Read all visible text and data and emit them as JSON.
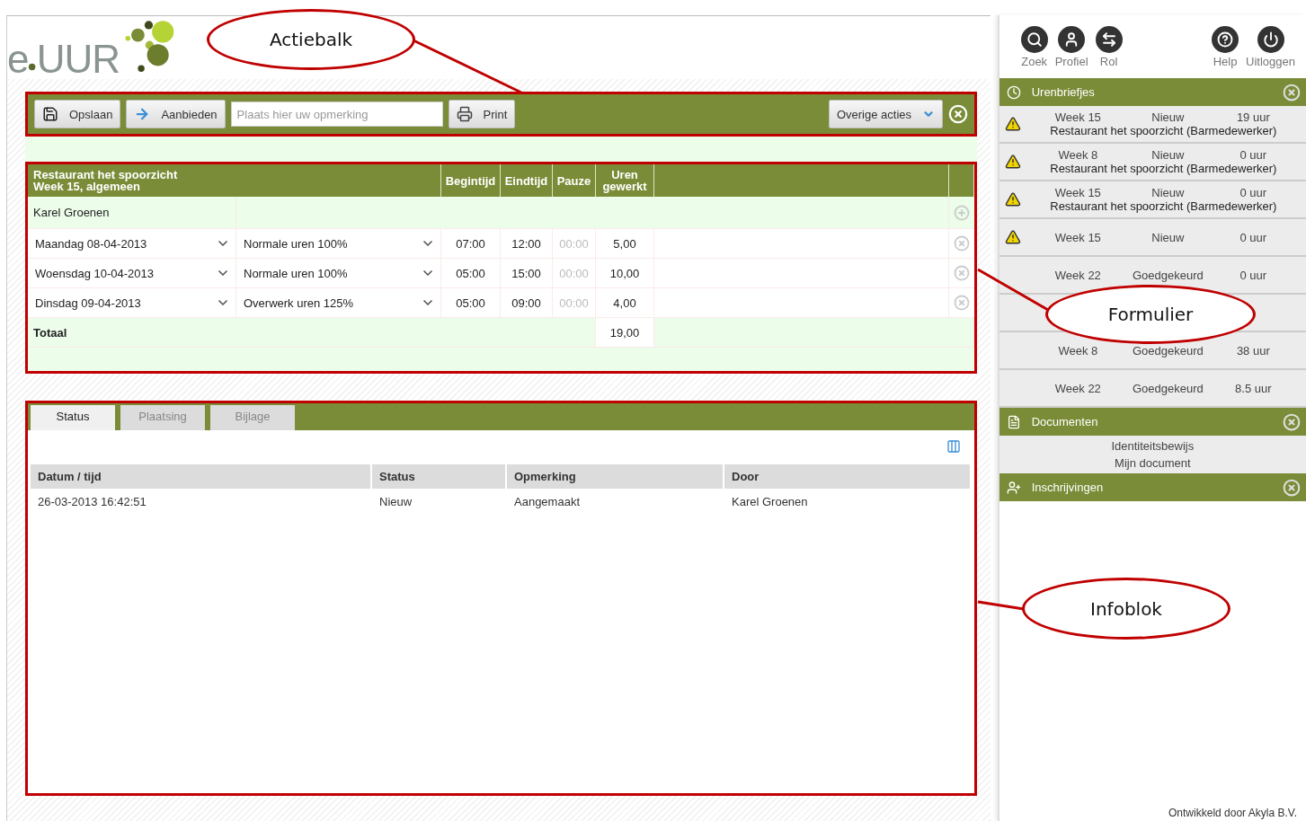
{
  "logo": {
    "left": "e",
    "right": "UUR"
  },
  "toolbar": {
    "items": [
      {
        "kind": "button",
        "label": "Opslaan"
      },
      {
        "kind": "button",
        "label": "Aanbieden"
      },
      {
        "kind": "field",
        "placeholder": "Plaats hier uw opmerking"
      },
      {
        "kind": "button",
        "label": "Print"
      }
    ],
    "menu": {
      "label": "Overige acties"
    }
  },
  "form": {
    "title": [
      "Restaurant het spoorzicht",
      "Week 15, algemeen"
    ],
    "columns": [
      "Begintijd",
      "Eindtijd",
      "Pauze",
      "Uren gewerkt"
    ],
    "employee": "Karel Groenen",
    "rows": [
      {
        "date": "Maandag 08-04-2013",
        "type": "Normale uren 100%",
        "start": "07:00",
        "end": "12:00",
        "pause": "00:00",
        "hours": "5,00"
      },
      {
        "date": "Woensdag 10-04-2013",
        "type": "Normale uren 100%",
        "start": "05:00",
        "end": "15:00",
        "pause": "00:00",
        "hours": "10,00"
      },
      {
        "date": "Dinsdag 09-04-2013",
        "type": "Overwerk uren 125%",
        "start": "05:00",
        "end": "09:00",
        "pause": "00:00",
        "hours": "4,00"
      }
    ],
    "total": {
      "label": "Totaal",
      "hours": "19,00"
    }
  },
  "info": {
    "tabs": [
      {
        "label": "Status",
        "selected": true
      },
      {
        "label": "Plaatsing",
        "selected": false
      },
      {
        "label": "Bijlage",
        "selected": false
      }
    ],
    "columns": [
      "Datum / tijd",
      "Status",
      "Opmerking",
      "Door"
    ],
    "rows": [
      [
        "26-03-2013 16:42:51",
        "Nieuw",
        "Aangemaakt",
        "Karel Groenen"
      ]
    ]
  },
  "sidebar": {
    "actions": [
      {
        "label": "Zoek"
      },
      {
        "label": "Profiel"
      },
      {
        "label": "Rol"
      },
      {
        "label": "Help"
      },
      {
        "label": "Uitloggen"
      }
    ],
    "panels": [
      {
        "title": "Urenbriefjes",
        "items": [
          {
            "kind": "sheet",
            "warning": true,
            "week": "Week 15",
            "status": "Nieuw",
            "hours": "19 uur",
            "client": "Restaurant het spoorzicht (Barmedewerker)"
          },
          {
            "kind": "sheet",
            "warning": true,
            "week": "Week 8",
            "status": "Nieuw",
            "hours": "0 uur",
            "client": "Restaurant het spoorzicht (Barmedewerker)"
          },
          {
            "kind": "sheet",
            "warning": true,
            "week": "Week 15",
            "status": "Nieuw",
            "hours": "0 uur",
            "client": "Restaurant het spoorzicht (Barmedewerker)"
          },
          {
            "kind": "sheet",
            "warning": true,
            "week": "Week 15",
            "status": "Nieuw",
            "hours": "0 uur"
          },
          {
            "kind": "sheet",
            "warning": false,
            "week": "Week 22",
            "status": "Goedgekeurd",
            "hours": "0 uur"
          },
          {
            "kind": "covered"
          },
          {
            "kind": "sheet",
            "warning": false,
            "week": "Week 8",
            "status": "Goedgekeurd",
            "hours": "38 uur"
          },
          {
            "kind": "sheet",
            "warning": false,
            "week": "Week 22",
            "status": "Goedgekeurd",
            "hours": "8.5 uur"
          }
        ]
      },
      {
        "title": "Documenten",
        "documents": [
          "Identiteitsbewijs",
          "Mijn document"
        ]
      },
      {
        "title": "Inschrijvingen"
      }
    ]
  },
  "footer": "Ontwikkeld door Akyla B.V.",
  "callouts": [
    {
      "label": "Actiebalk"
    },
    {
      "label": "Formulier"
    },
    {
      "label": "Infoblok"
    }
  ]
}
